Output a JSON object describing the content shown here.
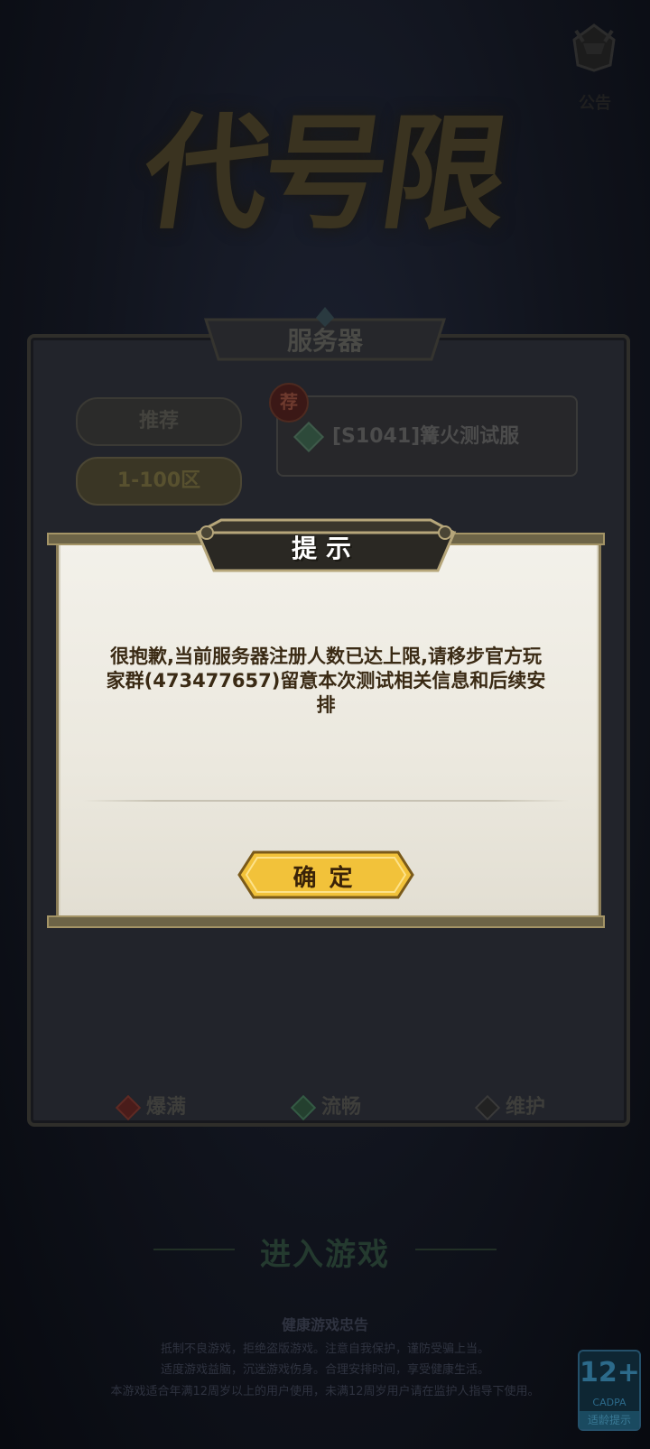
{
  "game_logo": "代号限",
  "notice": {
    "label": "公告"
  },
  "server_panel": {
    "title": "服务器",
    "tabs": [
      {
        "label": "推荐",
        "active": false
      },
      {
        "label": "1-100区",
        "active": true
      }
    ],
    "server": {
      "badge": "荐",
      "name": "[S1041]篝火测试服"
    },
    "legend": [
      {
        "label": "爆满",
        "color": "#5a1f1c"
      },
      {
        "label": "流畅",
        "color": "#2c4a3b"
      },
      {
        "label": "维护",
        "color": "#333333"
      }
    ]
  },
  "enter_game": "进入游戏",
  "health_advice": {
    "title": "健康游戏忠告",
    "line1": "抵制不良游戏，拒绝盗版游戏。注意自我保护，谨防受骗上当。",
    "line2": "适度游戏益脑，沉迷游戏伤身。合理安排时间，享受健康生活。",
    "line3": "本游戏适合年满12周岁以上的用户使用，未满12周岁用户请在监护人指导下使用。"
  },
  "age_rating": {
    "number": "12+",
    "org": "CADPA",
    "tip": "适龄提示"
  },
  "dialog": {
    "title": "提示",
    "message": "很抱歉,当前服务器注册人数已达上限,请移步官方玩家群(473477657)留意本次测试相关信息和后续安排",
    "confirm_label": "确定"
  }
}
